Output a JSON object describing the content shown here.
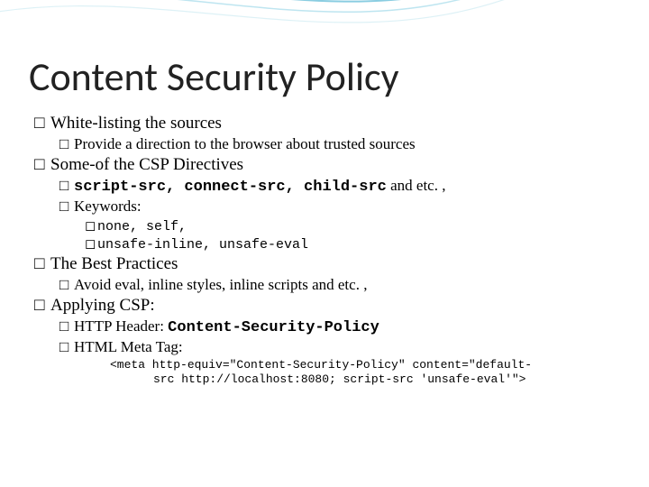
{
  "title": "Content Security Policy",
  "bullets": {
    "b1": "White-listing the sources",
    "b1a": "Provide a direction to the browser about trusted sources",
    "b2": "Some-of the CSP Directives",
    "b2a_codes": "script-src, connect-src, child-src",
    "b2a_tail": " and etc. ,",
    "b2b": "Keywords:",
    "b2b1": "none, self,",
    "b2b2": "unsafe-inline, unsafe-eval",
    "b3": "The Best Practices",
    "b3a": "Avoid eval, inline styles, inline scripts and etc. ,",
    "b4": "Applying CSP:",
    "b4a_label": "HTTP Header: ",
    "b4a_code": "Content-Security-Policy",
    "b4b": "HTML Meta Tag:",
    "meta_line1": "<meta http-equiv=\"Content-Security-Policy\" content=\"default-",
    "meta_line2": "src http://localhost:8080; script-src 'unsafe-eval'\">"
  },
  "glyphs": {
    "l1": "□ ",
    "l2": "□ ",
    "l3": "◻ "
  }
}
